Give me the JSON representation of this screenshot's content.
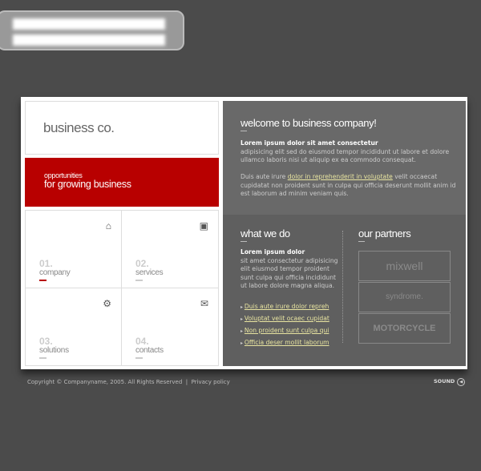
{
  "logo": "business co.",
  "banner": {
    "small": "opportunities",
    "big": "for growing business"
  },
  "tiles": [
    {
      "num": "01.",
      "label": "company",
      "icon": "home-icon",
      "accent": "#b80000"
    },
    {
      "num": "02.",
      "label": "services",
      "icon": "briefcase-icon"
    },
    {
      "num": "03.",
      "label": "solutions",
      "icon": "gear-icon"
    },
    {
      "num": "04.",
      "label": "contacts",
      "icon": "envelope-icon"
    }
  ],
  "welcome": {
    "title": "welcome to business company!",
    "bold": "Lorem ipsum dolor sit amet consectetur",
    "p1": "adipisicing elit sed do eiusmod tempor incididunt ut labore et dolore ullamco laboris nisi ut aliquip ex ea commodo consequat.",
    "p2_pre": "Duis aute irure ",
    "p2_link": "dolor in reprehenderit in voluptate",
    "p2_post": " velit occaecat cupidatat non proident sunt in culpa qui officia deserunt mollit anim id est laborum ad minim veniam quis."
  },
  "what": {
    "title": "what we do",
    "bold": "Lorem ipsum dolor",
    "text": "sit amet consectetur adipisicing elit eiusmod tempor  proident sunt culpa qui officia incididunt ut labore dolore magna aliqua.",
    "links": [
      "Duis aute irure dolor repreh",
      "Voluptat velit ocaec cupidat",
      "Non proident sunt culpa qui",
      "Officia deser mollit laborum"
    ]
  },
  "partners": {
    "title": "our partners",
    "items": [
      "mixwell",
      "syndrome.",
      "MOTORCYCLE"
    ]
  },
  "footer": {
    "copyright": "Copyright © Companyname, 2005. All Rights Reserved",
    "sep": "|",
    "privacy": "Privacy policy",
    "sound": "SOUND"
  },
  "colors": {
    "accent": "#b80000",
    "link": "#e8e4a0",
    "panel": "#696969"
  }
}
